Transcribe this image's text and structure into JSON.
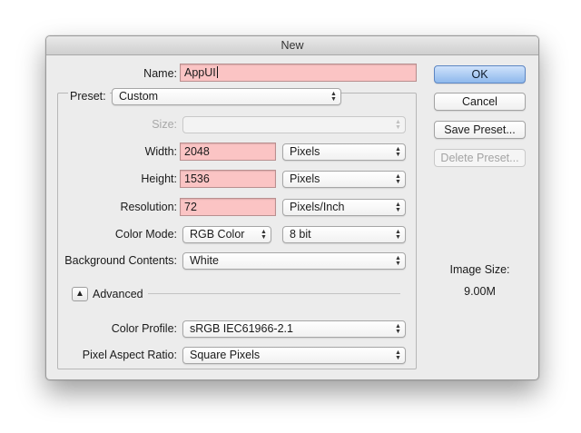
{
  "window": {
    "title": "New"
  },
  "name": {
    "label": "Name:",
    "value": "AppUI"
  },
  "preset": {
    "label": "Preset:",
    "value": "Custom"
  },
  "size": {
    "label": "Size:",
    "value": ""
  },
  "width": {
    "label": "Width:",
    "value": "2048",
    "unit": "Pixels"
  },
  "height": {
    "label": "Height:",
    "value": "1536",
    "unit": "Pixels"
  },
  "resolution": {
    "label": "Resolution:",
    "value": "72",
    "unit": "Pixels/Inch"
  },
  "color_mode": {
    "label": "Color Mode:",
    "value": "RGB Color",
    "depth": "8 bit"
  },
  "background": {
    "label": "Background Contents:",
    "value": "White"
  },
  "advanced": {
    "label": "Advanced",
    "icon": "triangle-up-icon"
  },
  "color_profile": {
    "label": "Color Profile:",
    "value": "sRGB IEC61966-2.1"
  },
  "pixel_aspect": {
    "label": "Pixel Aspect Ratio:",
    "value": "Square Pixels"
  },
  "buttons": {
    "ok": "OK",
    "cancel": "Cancel",
    "save_preset": "Save Preset...",
    "delete_preset": "Delete Preset..."
  },
  "image_size": {
    "label": "Image Size:",
    "value": "9.00M"
  },
  "colors": {
    "field_highlight": "#fbc4c4",
    "primary_button": "#8eb8ec",
    "dialog_bg": "#ececec"
  }
}
